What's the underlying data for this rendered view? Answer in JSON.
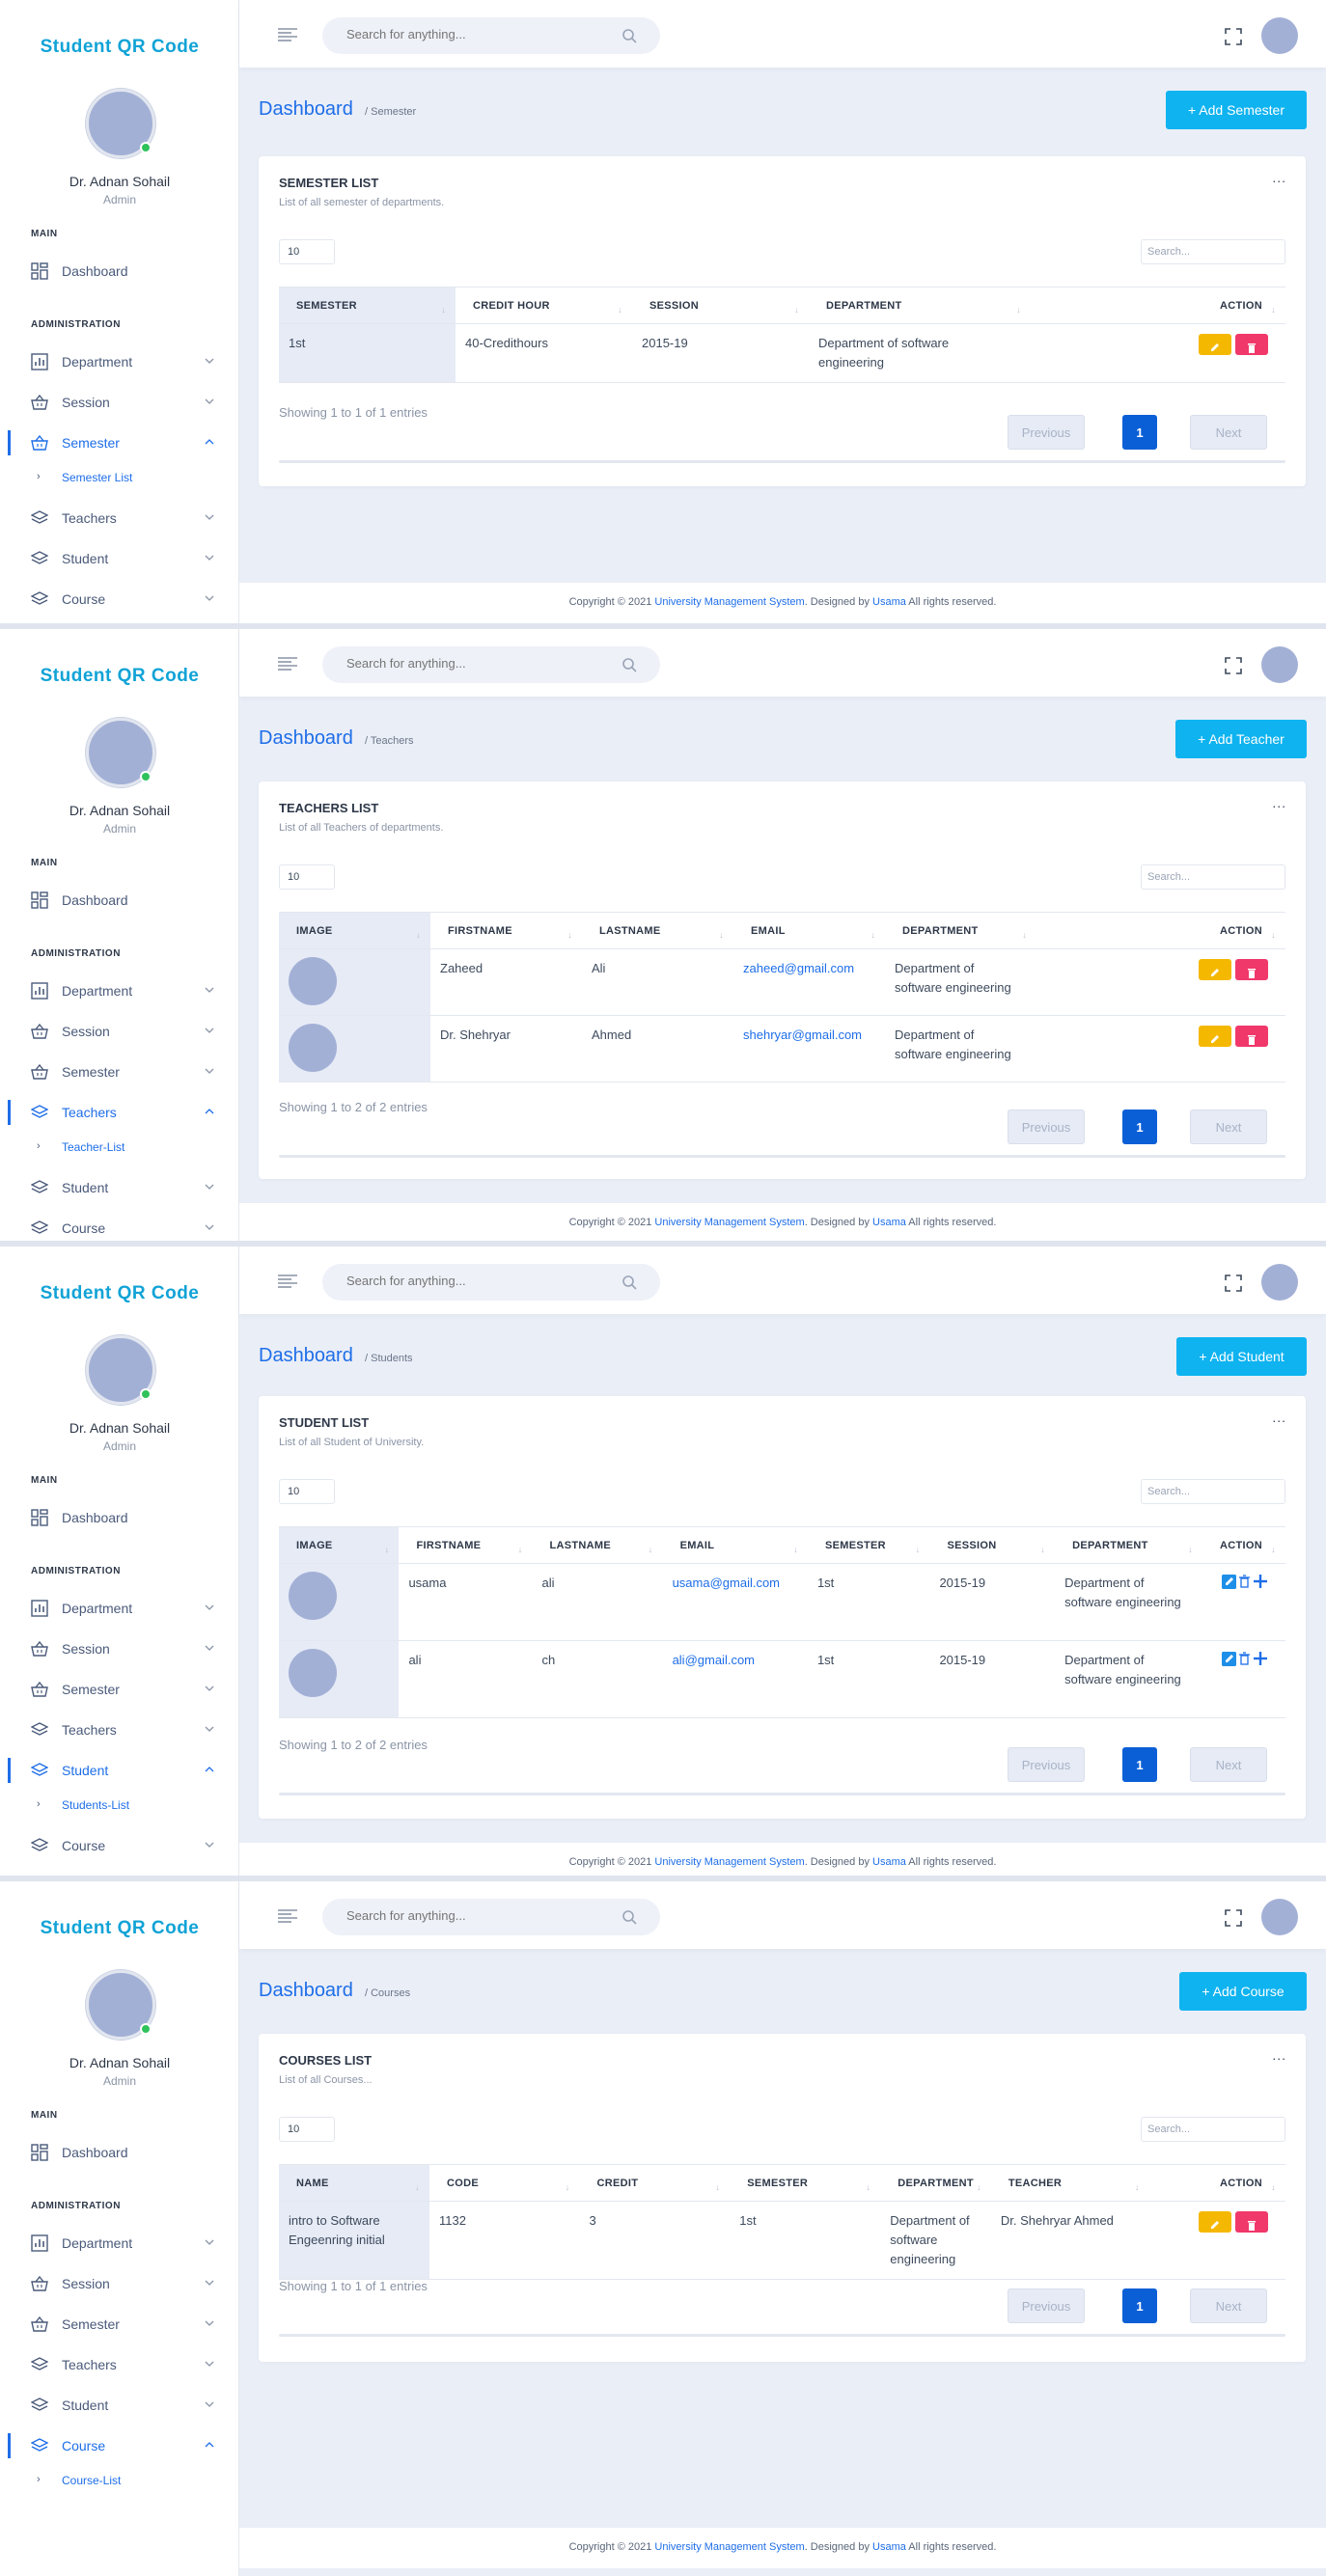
{
  "brand": "Student QR Code",
  "user": {
    "name": "Dr. Adnan Sohail",
    "role": "Admin"
  },
  "nav": {
    "main_heading": "MAIN",
    "admin_heading": "ADMINISTRATION",
    "dashboard": "Dashboard",
    "department": "Department",
    "session": "Session",
    "semester": "Semester",
    "teachers": "Teachers",
    "student": "Student",
    "course": "Course"
  },
  "search_placeholder": "Search for anything...",
  "footer": {
    "prefix": "Copyright © 2021 ",
    "link1": "University Management System",
    "middle": ". Designed by ",
    "link2": "Usama",
    "suffix": " All rights reserved."
  },
  "common": {
    "page_length": "10",
    "table_search_placeholder": "Search...",
    "previous": "Previous",
    "next": "Next",
    "current_page": "1",
    "action": "ACTION",
    "more": "..."
  },
  "panels": [
    {
      "title": "Dashboard",
      "crumb": "/ Semester",
      "add_button": "+ Add Semester",
      "sub_item": "Semester List",
      "card_title": "SEMESTER LIST",
      "card_sub": "List of all semester of departments.",
      "columns": [
        "SEMESTER",
        "CREDIT HOUR",
        "SESSION",
        "DEPARTMENT"
      ],
      "rows": [
        [
          "1st",
          "40-Credithours",
          "2015-19",
          "Department of software engineering"
        ]
      ],
      "info": "Showing 1 to 1 of 1 entries"
    },
    {
      "title": "Dashboard",
      "crumb": "/ Teachers",
      "add_button": "+ Add Teacher",
      "sub_item": "Teacher-List",
      "card_title": "TEACHERS LIST",
      "card_sub": "List of all Teachers of departments.",
      "columns": [
        "IMAGE",
        "FIRSTNAME",
        "LASTNAME",
        "EMAIL",
        "DEPARTMENT"
      ],
      "rows": [
        [
          "",
          "Zaheed",
          "Ali",
          "zaheed@gmail.com",
          "Department of software engineering"
        ],
        [
          "",
          "Dr. Shehryar",
          "Ahmed",
          "shehryar@gmail.com",
          "Department of software engineering"
        ]
      ],
      "info": "Showing 1 to 2 of 2 entries"
    },
    {
      "title": "Dashboard",
      "crumb": "/ Students",
      "add_button": "+ Add Student",
      "sub_item": "Students-List",
      "card_title": "STUDENT LIST",
      "card_sub": "List of all Student of University.",
      "columns": [
        "IMAGE",
        "FIRSTNAME",
        "LASTNAME",
        "EMAIL",
        "SEMESTER",
        "SESSION",
        "DEPARTMENT"
      ],
      "rows": [
        [
          "",
          "usama",
          "ali",
          "usama@gmail.com",
          "1st",
          "2015-19",
          "Department of software engineering"
        ],
        [
          "",
          "ali",
          "ch",
          "ali@gmail.com",
          "1st",
          "2015-19",
          "Department of software engineering"
        ]
      ],
      "info": "Showing 1 to 2 of 2 entries"
    },
    {
      "title": "Dashboard",
      "crumb": "/ Courses",
      "add_button": "+ Add Course",
      "sub_item": "Course-List",
      "card_title": "COURSES LIST",
      "card_sub": "List of all Courses...",
      "columns": [
        "NAME",
        "CODE",
        "CREDIT",
        "SEMESTER",
        "DEPARTMENT",
        "TEACHER"
      ],
      "rows": [
        [
          "intro to Software Engeenring initial",
          "1132",
          "3",
          "1st",
          "Department of software engineering",
          "Dr. Shehryar Ahmed"
        ]
      ],
      "info": "Showing 1 to 1 of 1 entries"
    }
  ],
  "colors": {
    "accent": "#1e6ee8",
    "brand": "#11a3d6",
    "add_button": "#0fb3f0",
    "edit": "#f5b800",
    "delete": "#f0386b"
  }
}
